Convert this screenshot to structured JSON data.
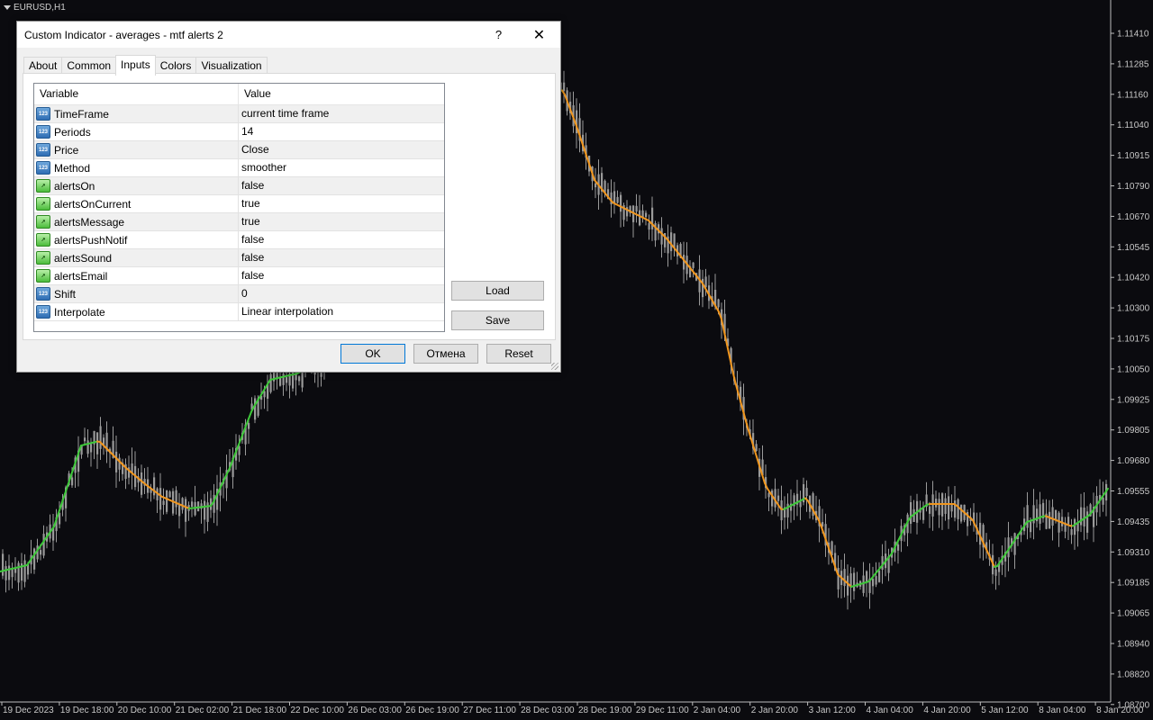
{
  "chart": {
    "symbol_label": "EURUSD,H1",
    "price_ticks": [
      "1.11410",
      "1.11285",
      "1.11160",
      "1.11040",
      "1.10915",
      "1.10790",
      "1.10670",
      "1.10545",
      "1.10420",
      "1.10300",
      "1.10175",
      "1.10050",
      "1.09925",
      "1.09805",
      "1.09680",
      "1.09555",
      "1.09435",
      "1.09310",
      "1.09185",
      "1.09065",
      "1.08940",
      "1.08820",
      "1.08700"
    ],
    "time_ticks": [
      "19 Dec 2023",
      "19 Dec 18:00",
      "20 Dec 10:00",
      "21 Dec 02:00",
      "21 Dec 18:00",
      "22 Dec 10:00",
      "26 Dec 03:00",
      "26 Dec 19:00",
      "27 Dec 11:00",
      "28 Dec 03:00",
      "28 Dec 19:00",
      "29 Dec 11:00",
      "2 Jan 04:00",
      "2 Jan 20:00",
      "3 Jan 12:00",
      "4 Jan 04:00",
      "4 Jan 20:00",
      "5 Jan 12:00",
      "8 Jan 04:00",
      "8 Jan 20:00"
    ],
    "colors": {
      "background": "#0b0b0f",
      "candle": "#9a9a9a",
      "ma_up": "#3ec83a",
      "ma_down": "#f0961e",
      "axis_text": "#c8c8c8"
    }
  },
  "dialog": {
    "title": "Custom Indicator - averages - mtf alerts 2",
    "help_glyph": "?",
    "close_glyph": "✕",
    "tabs": [
      {
        "label": "About",
        "active": false
      },
      {
        "label": "Common",
        "active": false
      },
      {
        "label": "Inputs",
        "active": true
      },
      {
        "label": "Colors",
        "active": false
      },
      {
        "label": "Visualization",
        "active": false
      }
    ],
    "grid": {
      "headers": {
        "variable": "Variable",
        "value": "Value"
      },
      "rows": [
        {
          "name": "TimeFrame",
          "value": "current time frame",
          "icon": "number-icon"
        },
        {
          "name": "Periods",
          "value": "14",
          "icon": "number-icon"
        },
        {
          "name": "Price",
          "value": "Close",
          "icon": "number-icon"
        },
        {
          "name": "Method",
          "value": "smoother",
          "icon": "number-icon"
        },
        {
          "name": "alertsOn",
          "value": "false",
          "icon": "boolean-icon"
        },
        {
          "name": "alertsOnCurrent",
          "value": "true",
          "icon": "boolean-icon"
        },
        {
          "name": "alertsMessage",
          "value": "true",
          "icon": "boolean-icon"
        },
        {
          "name": "alertsPushNotif",
          "value": "false",
          "icon": "boolean-icon"
        },
        {
          "name": "alertsSound",
          "value": "false",
          "icon": "boolean-icon"
        },
        {
          "name": "alertsEmail",
          "value": "false",
          "icon": "boolean-icon"
        },
        {
          "name": "Shift",
          "value": "0",
          "icon": "number-icon"
        },
        {
          "name": "Interpolate",
          "value": "Linear interpolation",
          "icon": "number-icon"
        }
      ]
    },
    "buttons": {
      "load": "Load",
      "save": "Save",
      "ok": "OK",
      "cancel": "Отмена",
      "reset": "Reset"
    }
  }
}
